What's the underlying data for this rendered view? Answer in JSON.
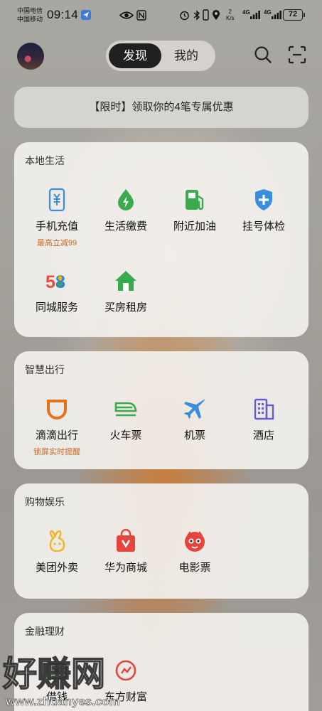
{
  "status_bar": {
    "carrier_1": "中国电信",
    "carrier_2": "中国移动",
    "time": "09:14",
    "net_speed_value": "2",
    "net_speed_unit": "K/s",
    "signal_1": "4G",
    "signal_2": "4G",
    "battery": "72"
  },
  "header": {
    "tab_discover": "发现",
    "tab_mine": "我的",
    "active_tab": "发现"
  },
  "banner": {
    "text": "【限时】领取你的4笔专属优惠"
  },
  "sections": [
    {
      "title": "本地生活",
      "items": [
        {
          "label": "手机充值",
          "sub": "最高立减99",
          "icon": "phone-recharge-icon"
        },
        {
          "label": "生活缴费",
          "icon": "utility-bill-icon"
        },
        {
          "label": "附近加油",
          "icon": "gas-station-icon"
        },
        {
          "label": "挂号体检",
          "icon": "medical-shield-icon"
        },
        {
          "label": "同城服务",
          "icon": "58-logo-icon"
        },
        {
          "label": "买房租房",
          "icon": "house-icon"
        }
      ]
    },
    {
      "title": "智慧出行",
      "items": [
        {
          "label": "滴滴出行",
          "sub": "锁屏实时提醒",
          "icon": "didi-icon"
        },
        {
          "label": "火车票",
          "icon": "train-icon"
        },
        {
          "label": "机票",
          "icon": "airplane-icon"
        },
        {
          "label": "酒店",
          "icon": "hotel-icon"
        }
      ]
    },
    {
      "title": "购物娱乐",
      "items": [
        {
          "label": "美团外卖",
          "icon": "meituan-icon"
        },
        {
          "label": "华为商城",
          "icon": "shopping-bag-icon"
        },
        {
          "label": "电影票",
          "icon": "movie-ticket-icon"
        }
      ]
    },
    {
      "title": "金融理财",
      "items": [
        {
          "label": "借钱",
          "icon": "loan-icon"
        },
        {
          "label": "东方财富",
          "icon": "east-money-icon"
        }
      ]
    }
  ],
  "watermark": {
    "text": "好赚网",
    "url": "www.zhuanyes.com"
  },
  "colors": {
    "accent_orange": "#e8701f",
    "sub_text": "#c76a28",
    "green": "#3aaa4e",
    "blue": "#3a8fdc",
    "red": "#e5453b"
  }
}
